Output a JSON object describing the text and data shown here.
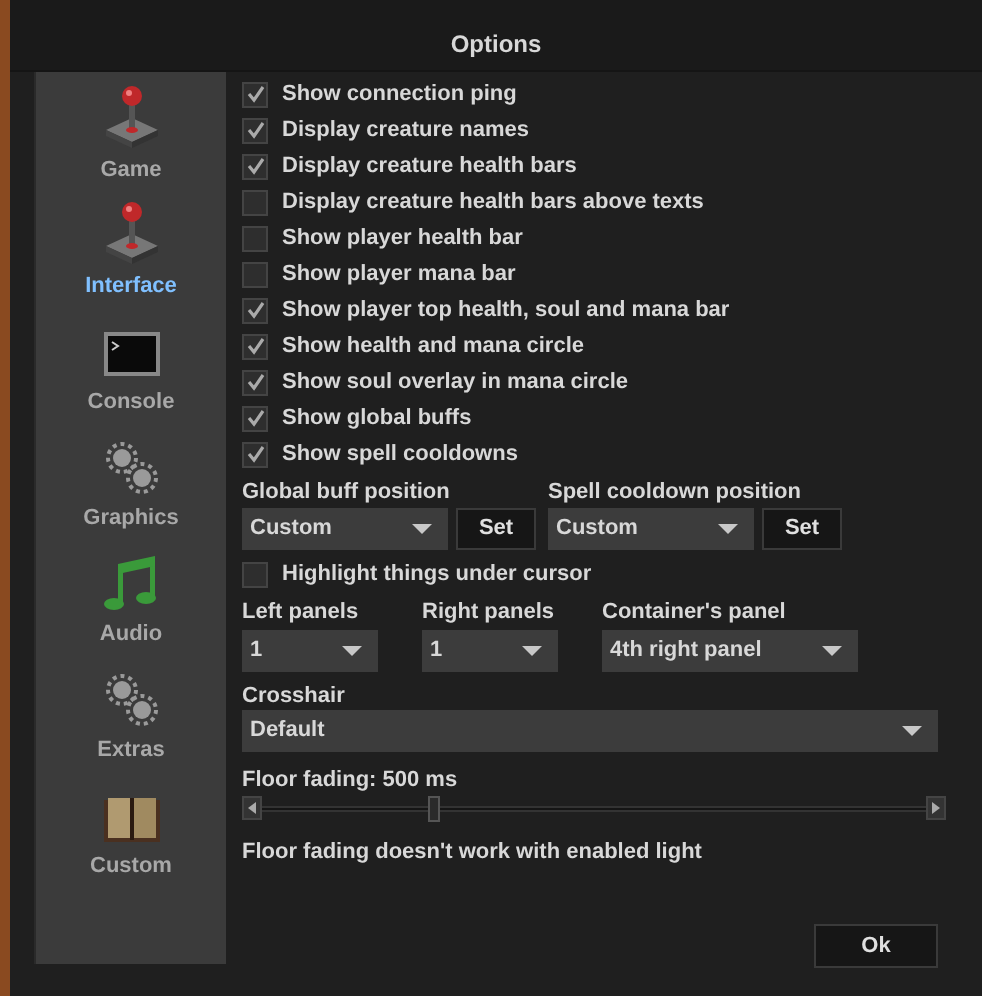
{
  "window": {
    "title": "Options"
  },
  "sidebar": {
    "items": [
      {
        "label": "Game",
        "selected": false
      },
      {
        "label": "Interface",
        "selected": true
      },
      {
        "label": "Console",
        "selected": false
      },
      {
        "label": "Graphics",
        "selected": false
      },
      {
        "label": "Audio",
        "selected": false
      },
      {
        "label": "Extras",
        "selected": false
      },
      {
        "label": "Custom",
        "selected": false
      }
    ]
  },
  "checkboxes": [
    {
      "label": "Show connection ping",
      "checked": true
    },
    {
      "label": "Display creature names",
      "checked": true
    },
    {
      "label": "Display creature health bars",
      "checked": true
    },
    {
      "label": "Display creature health bars above texts",
      "checked": false
    },
    {
      "label": "Show player health bar",
      "checked": false
    },
    {
      "label": "Show player mana bar",
      "checked": false
    },
    {
      "label": "Show player top health, soul and mana bar",
      "checked": true
    },
    {
      "label": "Show health and mana circle",
      "checked": true
    },
    {
      "label": "Show soul overlay in mana circle",
      "checked": true
    },
    {
      "label": "Show global buffs",
      "checked": true
    },
    {
      "label": "Show spell cooldowns",
      "checked": true
    }
  ],
  "positions": [
    {
      "label": "Global buff position",
      "value": "Custom",
      "button": "Set"
    },
    {
      "label": "Spell cooldown position",
      "value": "Custom",
      "button": "Set"
    }
  ],
  "highlight": {
    "label": "Highlight things under cursor",
    "checked": false
  },
  "panels": [
    {
      "label": "Left panels",
      "value": "1"
    },
    {
      "label": "Right panels",
      "value": "1"
    },
    {
      "label": "Container's panel",
      "value": "4th right panel"
    }
  ],
  "crosshair": {
    "label": "Crosshair",
    "value": "Default"
  },
  "floor_fading": {
    "label": "Floor fading: 500 ms",
    "level": 0.26,
    "note": "Floor fading doesn't work with enabled light"
  },
  "ok_button": "Ok"
}
